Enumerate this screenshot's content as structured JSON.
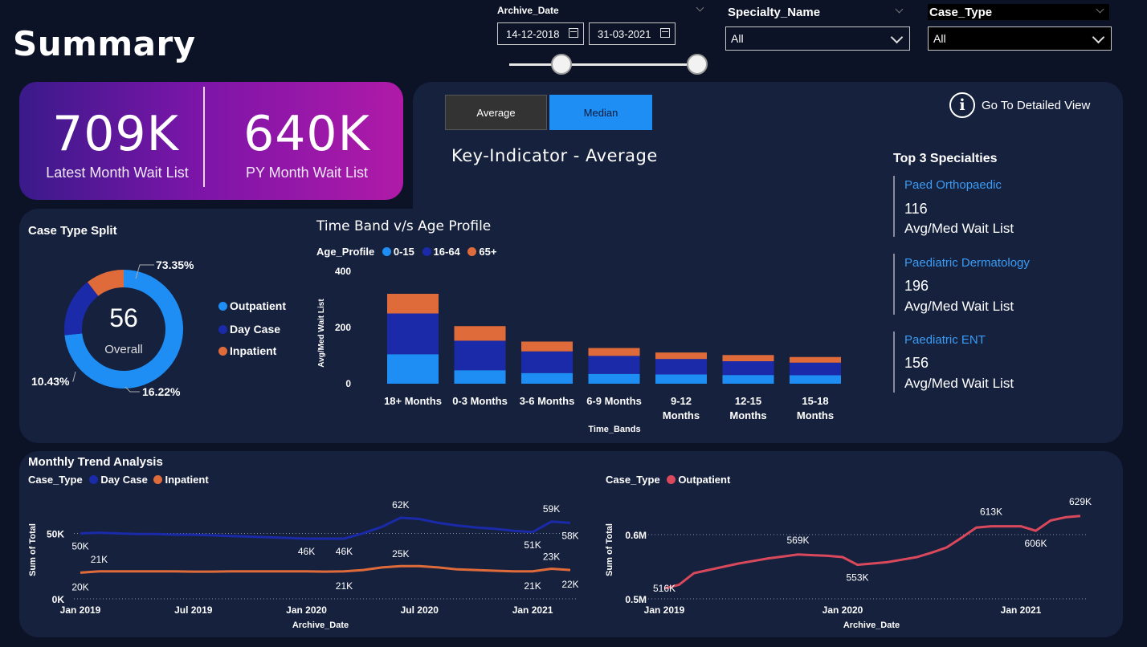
{
  "page_title": "Summary",
  "archive_date": {
    "label": "Archive_Date",
    "start": "14-12-2018",
    "end": "31-03-2021"
  },
  "specialty": {
    "label": "Specialty_Name",
    "value": "All"
  },
  "case_type": {
    "label": "Case_Type",
    "value": "All"
  },
  "kpi": {
    "latest_value": "709K",
    "latest_label": "Latest Month Wait List",
    "py_value": "640K",
    "py_label": "PY Month Wait List"
  },
  "toggle": {
    "average": "Average",
    "median": "Median"
  },
  "detail_link": "Go To Detailed View",
  "key_indicator_title": "Key-Indicator - Average",
  "top3": {
    "title": "Top 3 Specialties",
    "items": [
      {
        "name": "Paed Orthopaedic",
        "value": "116",
        "sub": "Avg/Med Wait List"
      },
      {
        "name": "Paediatric Dermatology",
        "value": "196",
        "sub": "Avg/Med Wait List"
      },
      {
        "name": "Paediatric ENT",
        "value": "156",
        "sub": "Avg/Med Wait List"
      }
    ]
  },
  "donut": {
    "title": "Case Type Split",
    "center_value": "56",
    "center_label": "Overall",
    "legend": [
      "Outpatient",
      "Day Case",
      "Inpatient"
    ]
  },
  "bar": {
    "title": "Time Band v/s Age Profile",
    "legend_title": "Age_Profile",
    "x_title": "Time_Bands"
  },
  "trend": {
    "title": "Monthly Trend Analysis",
    "left_legend_title": "Case_Type",
    "right_legend_title": "Case_Type"
  },
  "colors": {
    "outpatient": "#1e8ef5",
    "day_case": "#1a2aa8",
    "inpatient": "#e06b3a",
    "age_0_15": "#1e8ef5",
    "age_16_64": "#1a2aa8",
    "age_65": "#e06b3a",
    "trend_outpatient": "#d9485b",
    "panel": "#16213e"
  },
  "chart_data": [
    {
      "type": "pie",
      "title": "Case Type Split",
      "categories": [
        "Outpatient",
        "Day Case",
        "Inpatient"
      ],
      "values": [
        73.35,
        16.22,
        10.43
      ],
      "labels": [
        "73.35%",
        "16.22%",
        "10.43%"
      ]
    },
    {
      "type": "bar",
      "title": "Time Band v/s Age Profile",
      "stacked": true,
      "xlabel": "Time_Bands",
      "ylabel": "Avg/Med Wait List",
      "ylim": [
        0,
        400
      ],
      "yticks": [
        0,
        200,
        400
      ],
      "categories": [
        "18+ Months",
        "0-3 Months",
        "3-6 Months",
        "6-9 Months",
        "9-12 Months",
        "12-15 Months",
        "15-18 Months"
      ],
      "series": [
        {
          "name": "0-15",
          "values": [
            105,
            48,
            38,
            35,
            33,
            31,
            30
          ]
        },
        {
          "name": "16-64",
          "values": [
            145,
            105,
            77,
            64,
            55,
            49,
            45
          ]
        },
        {
          "name": "65+",
          "values": [
            70,
            52,
            35,
            28,
            23,
            22,
            20
          ]
        }
      ]
    },
    {
      "type": "line",
      "title": "Monthly Trend Analysis",
      "xlabel": "Archive_Date",
      "ylabel": "Sum of Total",
      "y_ticks": [
        "0K",
        "50K"
      ],
      "ylim": [
        0,
        65
      ],
      "x_ticks": [
        "Jan 2019",
        "Jul 2019",
        "Jan 2020",
        "Jul 2020",
        "Jan 2021"
      ],
      "x": [
        "Jan 2019",
        "Feb 2019",
        "Mar 2019",
        "Apr 2019",
        "May 2019",
        "Jun 2019",
        "Jul 2019",
        "Aug 2019",
        "Sep 2019",
        "Oct 2019",
        "Nov 2019",
        "Dec 2019",
        "Jan 2020",
        "Feb 2020",
        "Mar 2020",
        "Apr 2020",
        "May 2020",
        "Jun 2020",
        "Jul 2020",
        "Aug 2020",
        "Sep 2020",
        "Oct 2020",
        "Nov 2020",
        "Dec 2020",
        "Jan 2021",
        "Feb 2021",
        "Mar 2021"
      ],
      "series": [
        {
          "name": "Day Case",
          "values": [
            50,
            50.5,
            50,
            49.5,
            49.5,
            49,
            49,
            48.5,
            48,
            47.5,
            47,
            46.5,
            46,
            46,
            46,
            50,
            55,
            62,
            61,
            58,
            56,
            54.5,
            53.5,
            52,
            51,
            59,
            58
          ],
          "labels": {
            "0": "50K",
            "12": "46K",
            "14": "46K",
            "17": "62K",
            "24": "51K",
            "25": "59K",
            "26": "58K"
          }
        },
        {
          "name": "Inpatient",
          "values": [
            20,
            21,
            21,
            21,
            21,
            21,
            20.8,
            20.8,
            21,
            21,
            21,
            21,
            21,
            20.8,
            21,
            22,
            24,
            25,
            25,
            24,
            22.5,
            22,
            21.5,
            21,
            21,
            23,
            22
          ],
          "labels": {
            "0": "20K",
            "1": "21K",
            "14": "21K",
            "17": "25K",
            "24": "21K",
            "25": "23K",
            "26": "22K"
          }
        }
      ]
    },
    {
      "type": "line",
      "xlabel": "Archive_Date",
      "ylabel": "Sum of Total",
      "y_ticks": [
        "0.5M",
        "0.6M"
      ],
      "ylim": [
        500,
        620
      ],
      "x_ticks": [
        "Jan 2019",
        "Jan 2020",
        "Jan 2021"
      ],
      "x": [
        "Jan 2019",
        "Feb 2019",
        "Mar 2019",
        "Apr 2019",
        "May 2019",
        "Jun 2019",
        "Jul 2019",
        "Aug 2019",
        "Sep 2019",
        "Oct 2019",
        "Nov 2019",
        "Dec 2019",
        "Jan 2020",
        "Feb 2020",
        "Mar 2020",
        "Apr 2020",
        "May 2020",
        "Jun 2020",
        "Jul 2020",
        "Aug 2020",
        "Sep 2020",
        "Oct 2020",
        "Nov 2020",
        "Dec 2020",
        "Jan 2021",
        "Feb 2021",
        "Mar 2021"
      ],
      "series": [
        {
          "name": "Outpatient",
          "values": [
            516,
            522,
            540,
            545,
            550,
            555,
            559,
            563,
            566,
            569,
            568,
            567,
            565,
            553,
            555,
            557,
            561,
            565,
            572,
            580,
            595,
            611,
            613,
            613,
            613,
            606,
            622,
            627,
            629
          ],
          "labels": {
            "0": "516K",
            "9": "569K",
            "13": "553K",
            "22": "613K",
            "25": "606K",
            "28": "629K"
          }
        }
      ]
    }
  ]
}
